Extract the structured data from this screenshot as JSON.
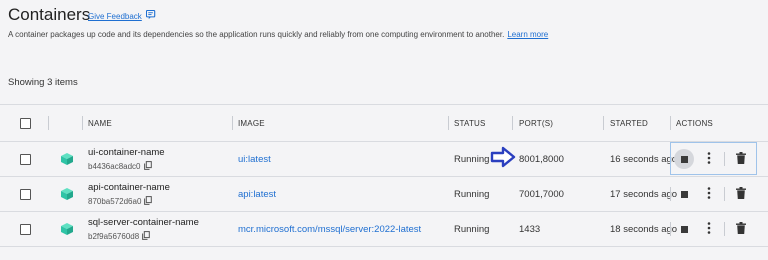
{
  "header": {
    "title": "Containers",
    "feedback_label": "Give Feedback",
    "description": "A container packages up code and its dependencies so the application runs quickly and reliably from one computing environment to another.",
    "learn_more": "Learn more"
  },
  "showing": "Showing 3 items",
  "columns": {
    "name": "NAME",
    "image": "IMAGE",
    "status": "STATUS",
    "ports": "PORT(S)",
    "started": "STARTED",
    "actions": "ACTIONS"
  },
  "rows": [
    {
      "name": "ui-container-name",
      "id": "b4436ac8adc0",
      "image": "ui:latest",
      "status": "Running",
      "ports": "8001,8000",
      "started": "16 seconds ago"
    },
    {
      "name": "api-container-name",
      "id": "870ba572d6a0",
      "image": "api:latest",
      "status": "Running",
      "ports": "7001,7000",
      "started": "17 seconds ago"
    },
    {
      "name": "sql-server-container-name",
      "id": "b2f9a56760d8",
      "image": "mcr.microsoft.com/mssql/server:2022-latest",
      "status": "Running",
      "ports": "1433",
      "started": "18 seconds ago"
    }
  ],
  "colors": {
    "accent": "#1f6fd1",
    "cube": "#2fc4a6",
    "arrow": "#2a3fbf"
  },
  "icons": {
    "feedback": "chat-feedback-icon",
    "container": "cube-icon",
    "copy": "copy-icon",
    "stop": "stop-icon",
    "more": "more-vertical-icon",
    "delete": "trash-icon",
    "pointer": "arrow-right-icon"
  }
}
